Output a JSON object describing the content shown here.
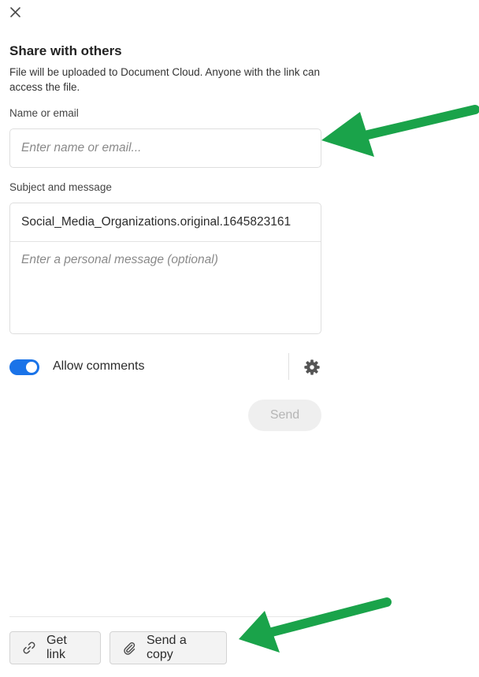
{
  "dialog": {
    "title": "Share with others",
    "description": "File will be uploaded to Document Cloud. Anyone with the link can access the file."
  },
  "recipient": {
    "label": "Name or email",
    "placeholder": "Enter name or email...",
    "value": ""
  },
  "message": {
    "label": "Subject and message",
    "subject": "Social_Media_Organizations.original.1645823161",
    "placeholder": "Enter a personal message (optional)"
  },
  "comments": {
    "label": "Allow comments",
    "enabled": true
  },
  "send_label": "Send",
  "footer": {
    "get_link_label": "Get link",
    "send_copy_label": "Send a copy"
  },
  "icons": {
    "close": "close-icon",
    "settings": "gear-icon",
    "link": "link-icon",
    "attachment": "paperclip-icon"
  },
  "colors": {
    "accent": "#1a73e8",
    "annotation_arrow": "#1aa34a",
    "send_disabled_text": "#b5b5b5"
  }
}
